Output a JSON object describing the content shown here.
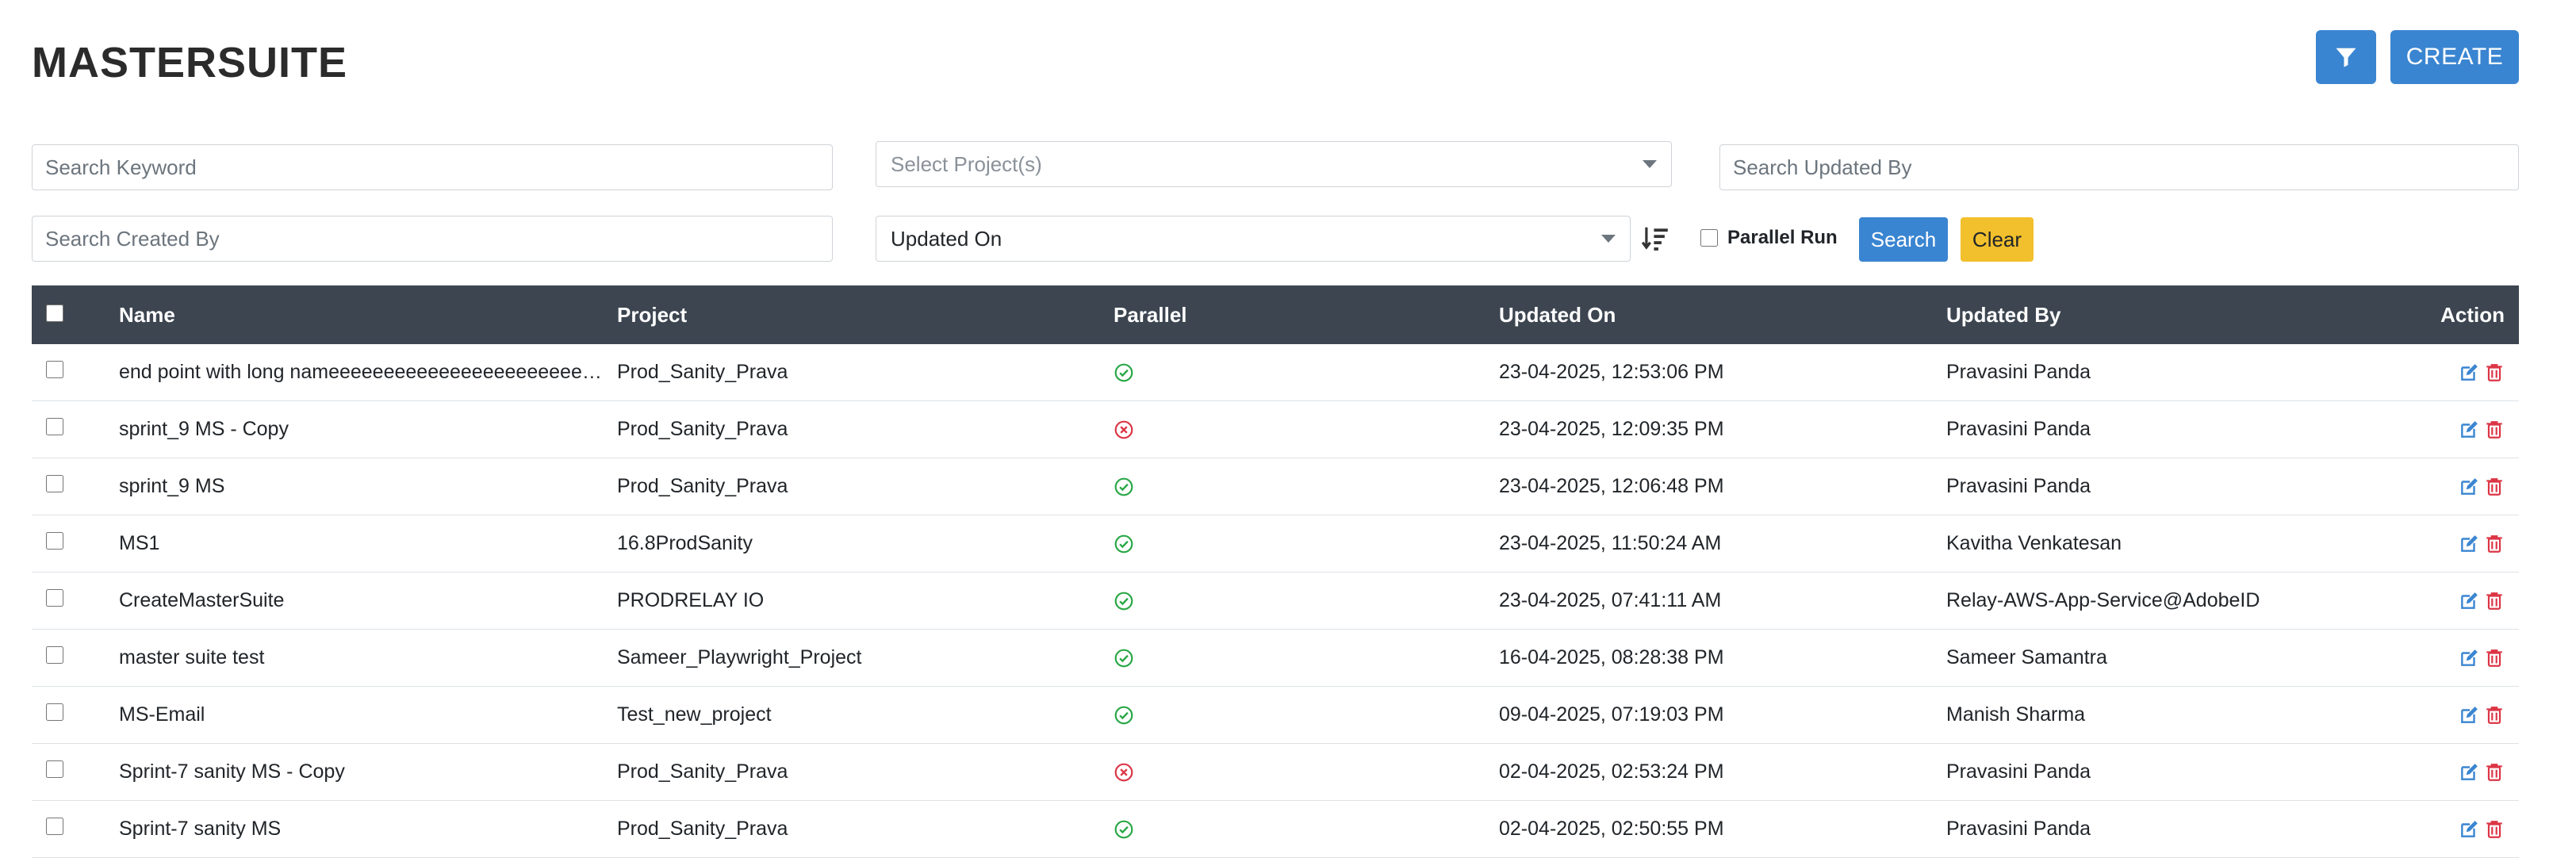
{
  "page": {
    "title": "MASTERSUITE"
  },
  "toolbar": {
    "filter_icon": "filter-icon",
    "create_label": "CREATE"
  },
  "filters": {
    "search_keyword_placeholder": "Search Keyword",
    "select_projects_placeholder": "Select Project(s)",
    "search_updated_by_placeholder": "Search Updated By",
    "search_created_by_placeholder": "Search Created By",
    "sort_field_value": "Updated On",
    "parallel_run_label": "Parallel Run",
    "search_label": "Search",
    "clear_label": "Clear"
  },
  "colors": {
    "primary": "#3a85d1",
    "warning": "#f2c02c",
    "header_bg": "#3c4550",
    "success": "#28a745",
    "danger": "#dc3545"
  },
  "table": {
    "columns": {
      "name": "Name",
      "project": "Project",
      "parallel": "Parallel",
      "updated_on": "Updated On",
      "updated_by": "Updated By",
      "action": "Action"
    },
    "rows": [
      {
        "name": "end point with long nameeeeeeeeeeeeeeeeeeeeeeeeeeeeeeeeeeeeeeee",
        "project": "Prod_Sanity_Prava",
        "parallel": true,
        "updated_on": "23-04-2025, 12:53:06 PM",
        "updated_by": "Pravasini Panda"
      },
      {
        "name": "sprint_9 MS - Copy",
        "project": "Prod_Sanity_Prava",
        "parallel": false,
        "updated_on": "23-04-2025, 12:09:35 PM",
        "updated_by": "Pravasini Panda"
      },
      {
        "name": "sprint_9 MS",
        "project": "Prod_Sanity_Prava",
        "parallel": true,
        "updated_on": "23-04-2025, 12:06:48 PM",
        "updated_by": "Pravasini Panda"
      },
      {
        "name": "MS1",
        "project": "16.8ProdSanity",
        "parallel": true,
        "updated_on": "23-04-2025, 11:50:24 AM",
        "updated_by": "Kavitha Venkatesan"
      },
      {
        "name": "CreateMasterSuite",
        "project": "PRODRELAY IO",
        "parallel": true,
        "updated_on": "23-04-2025, 07:41:11 AM",
        "updated_by": "Relay-AWS-App-Service@AdobeID"
      },
      {
        "name": "master suite test",
        "project": "Sameer_Playwright_Project",
        "parallel": true,
        "updated_on": "16-04-2025, 08:28:38 PM",
        "updated_by": "Sameer Samantra"
      },
      {
        "name": "MS-Email",
        "project": "Test_new_project",
        "parallel": true,
        "updated_on": "09-04-2025, 07:19:03 PM",
        "updated_by": "Manish Sharma"
      },
      {
        "name": "Sprint-7 sanity MS - Copy",
        "project": "Prod_Sanity_Prava",
        "parallel": false,
        "updated_on": "02-04-2025, 02:53:24 PM",
        "updated_by": "Pravasini Panda"
      },
      {
        "name": "Sprint-7 sanity MS",
        "project": "Prod_Sanity_Prava",
        "parallel": true,
        "updated_on": "02-04-2025, 02:50:55 PM",
        "updated_by": "Pravasini Panda"
      }
    ]
  }
}
